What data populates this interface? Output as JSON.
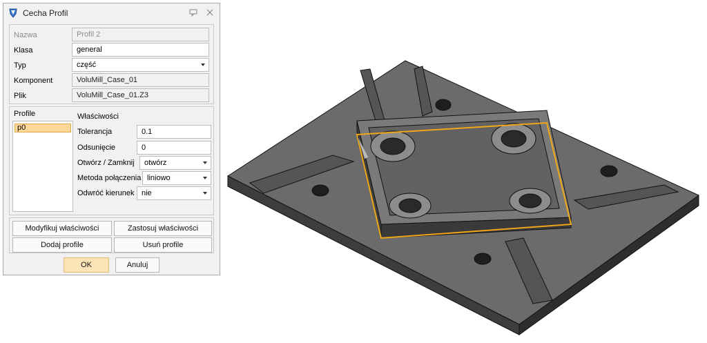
{
  "dialog": {
    "title": "Cecha Profil",
    "fields": {
      "nazwa": {
        "label": "Nazwa",
        "value": "Profil 2"
      },
      "klasa": {
        "label": "Klasa",
        "value": "general"
      },
      "typ": {
        "label": "Typ",
        "value": "część"
      },
      "komponent": {
        "label": "Komponent",
        "value": "VoluMill_Case_01"
      },
      "plik": {
        "label": "Plik",
        "value": "VoluMill_Case_01.Z3"
      }
    },
    "profiles": {
      "header": "Profile",
      "items": [
        "p0"
      ],
      "properties_header": "Właściwości",
      "tolerancja": {
        "label": "Tolerancja",
        "value": "0.1"
      },
      "odsuniecie": {
        "label": "Odsunięcie",
        "value": "0"
      },
      "otworz": {
        "label": "Otwórz  / Zamknij",
        "value": "otwórz"
      },
      "metoda": {
        "label": "Metoda połączenia",
        "value": "liniowo"
      },
      "odwroc": {
        "label": "Odwróć kierunek",
        "value": "nie"
      }
    },
    "buttons": {
      "modify": "Modyfikuj właściwości",
      "apply": "Zastosuj właściwości",
      "add": "Dodaj profile",
      "remove": "Usuń profile",
      "ok": "OK",
      "cancel": "Anuluj"
    }
  },
  "colors": {
    "dialog_bg": "#f1f1f1",
    "selection": "#fdd89a",
    "ok_button": "#fde4b7",
    "profile_outline": "#f0a818",
    "model_dark": "#4a4a4a",
    "model_light": "#6d6d6d"
  }
}
